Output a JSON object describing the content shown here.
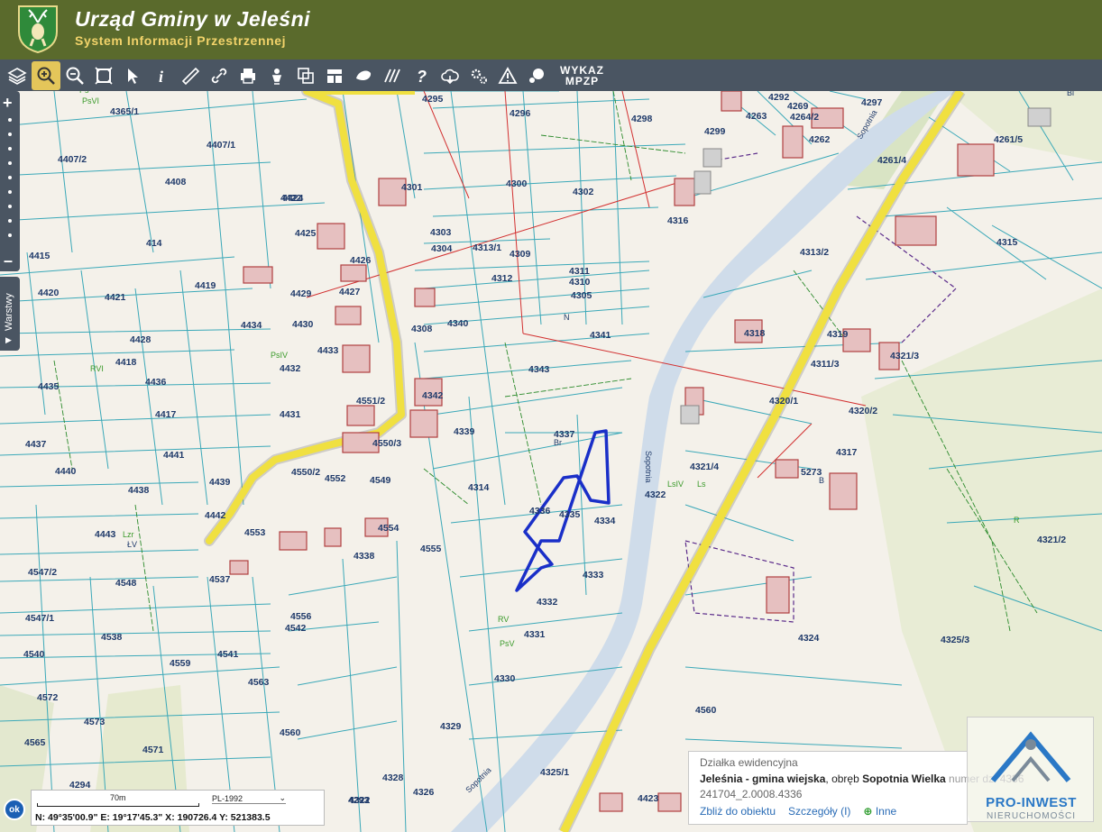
{
  "header": {
    "title": "Urząd Gminy w Jeleśni",
    "subtitle": "System Informacji Przestrzennej"
  },
  "toolbar": {
    "tools": [
      "layers-icon",
      "zoom-in-icon",
      "zoom-out-icon",
      "zoom-extent-icon",
      "pointer-icon",
      "info-icon",
      "measure-icon",
      "link-icon",
      "print-icon",
      "person-icon",
      "copy-icon",
      "layout-icon",
      "draw-icon",
      "hatch-icon",
      "help-icon",
      "cloud-icon",
      "settings-icon",
      "warning-icon",
      "comment-icon"
    ],
    "mpzp_line1": "WYKAZ",
    "mpzp_line2": "MPZP",
    "active_tool": "zoom-in-icon"
  },
  "sidebar": {
    "zoom_in": "+",
    "zoom_out": "–",
    "layers_label": "Warstwy"
  },
  "map": {
    "colors": {
      "background": "#f4f1ea",
      "parcel_line": "#3aa8b8",
      "road": "#f0e040",
      "selection": "#2233cc",
      "building": "#c0504d",
      "forest": "#e6ead2",
      "river": "#c9d8e8"
    },
    "parcels": [
      "4365/1",
      "4407/1",
      "4407/2",
      "4408",
      "4422",
      "414",
      "4415",
      "4420",
      "4421",
      "4419",
      "4428",
      "4434",
      "4418",
      "4435",
      "4436",
      "4417",
      "4437",
      "4441",
      "4440",
      "4438",
      "4439",
      "4442",
      "4443",
      "4547/2",
      "4548",
      "4537",
      "4547/1",
      "4538",
      "4540",
      "4572",
      "4573",
      "4565",
      "4571",
      "4294",
      "4295",
      "4296",
      "4298",
      "4299",
      "4300",
      "4301",
      "4302",
      "4303",
      "4304",
      "4313/1",
      "4309",
      "4312",
      "4311",
      "4310",
      "4305",
      "4308",
      "4340",
      "4341",
      "4343",
      "4342",
      "4339",
      "4314",
      "4337",
      "4336",
      "4335",
      "4334",
      "4333",
      "4332",
      "4331",
      "4330",
      "4329",
      "4328",
      "4326",
      "4325/1",
      "4423",
      "4424",
      "4425",
      "4426",
      "4427",
      "4429",
      "4430",
      "4433",
      "4432",
      "4431",
      "4551/2",
      "4550/3",
      "4550/2",
      "4552",
      "4549",
      "4553",
      "4554",
      "4338",
      "4555",
      "4556",
      "4542",
      "4541",
      "4559",
      "4563",
      "4560",
      "4293",
      "4292",
      "4269",
      "4264/2",
      "4297",
      "4263",
      "4262",
      "4261/4",
      "4261/5",
      "4315",
      "4313/2",
      "4316",
      "4318",
      "4319",
      "4321/3",
      "4311/3",
      "4320/1",
      "4320/2",
      "4317",
      "4321/4",
      "5273",
      "4322",
      "4321/2",
      "4324",
      "4325/3",
      "4560",
      "4322"
    ],
    "land_classes": [
      "Ps",
      "PsVI",
      "RVI",
      "Lzr",
      "ŁV",
      "R",
      "RV",
      "PsV",
      "Ls",
      "LsIV",
      "Br",
      "B",
      "N",
      "Bi",
      "PsIV"
    ],
    "streams": [
      "Sopotnia",
      "Sopotnia",
      "Sopotnia"
    ]
  },
  "popup": {
    "type": "Działka ewidencyjna",
    "place": "Jeleśnia - gmina wiejska",
    "sep": ", obręb ",
    "precinct": "Sopotnia Wielka",
    "number": " numer dz. 4336",
    "id": "241704_2.0008.4336",
    "action_zoom": "Zbliż do obiektu",
    "action_details": "Szczegóły (I)",
    "action_other": "Inne"
  },
  "footer": {
    "scale": "70m",
    "crs": "PL-1992",
    "coords": "N: 49°35'00.9\"  E: 19°17'45.3\"  X: 190726.4  Y: 521383.5",
    "ok": "ok"
  },
  "watermark": {
    "name": "PRO-INWEST",
    "sub": "NIERUCHOMOŚCI"
  }
}
